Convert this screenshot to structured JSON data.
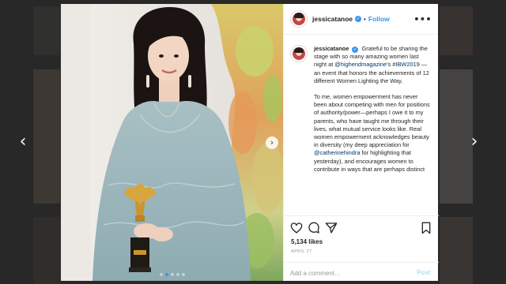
{
  "theme": {
    "accent": "#3897f0",
    "link": "#003569",
    "text": "#262626",
    "muted": "#999999",
    "overlay": "rgba(0,0,0,0.55)"
  },
  "navigation": {
    "prev_icon": "chevron-left-icon",
    "next_icon": "chevron-right-icon",
    "prev_glyph": "‹",
    "next_glyph": "›"
  },
  "photo": {
    "next_glyph": "›",
    "carousel_dots": 5,
    "active_dot_index": 1
  },
  "header": {
    "username": "jessicatanoe",
    "verified_glyph": "✓",
    "separator": "•",
    "follow_label": "Follow",
    "more_glyph": "•••"
  },
  "caption": {
    "username": "jessicatanoe",
    "text1": "Grateful to be sharing the stage with so many amazing women last night at ",
    "mention1": "@highendmagazine",
    "text2": "'s ",
    "hashtag": "#IBW2019",
    "text3": " — an event that honors the achievements of 12 different Women Lighting the Way.",
    "para2_start": "To me, women empowerment has never been about competing with men for positions of authority/power—perhaps I owe it to my parents, who have taught me through their lives, what mutual service looks like. Real women empowerment acknowledges beauty in diversity (my deep appreciation for ",
    "mention2": "@catherinehindra",
    "para2_end": " for highlighting that yesterday), and encourages women to contribute in ways that are perhaps distinct"
  },
  "actions": {
    "like_icon": "heart-icon",
    "comment_icon": "comment-icon",
    "share_icon": "share-icon",
    "save_icon": "bookmark-icon",
    "likes": "5,134 likes",
    "date": "APRIL 27"
  },
  "comment_box": {
    "placeholder": "Add a comment…",
    "post_label": "Post"
  }
}
